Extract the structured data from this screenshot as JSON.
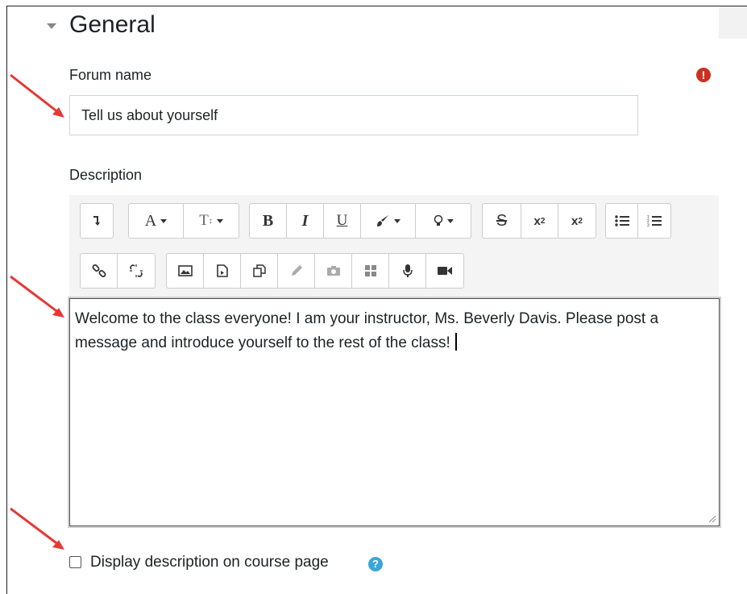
{
  "section": {
    "title": "General",
    "toggle_icon": "chevron-down-icon"
  },
  "forum_name": {
    "label": "Forum name",
    "value": "Tell us about yourself",
    "required_icon": "exclamation-circle-icon",
    "required_color": "#ca3120"
  },
  "description": {
    "label": "Description",
    "text": "Welcome to the class everyone! I am your instructor, Ms. Beverly Davis. Please post a message and introduce yourself to the rest of the class!",
    "toolbar_row1": [
      [
        "collapse-toolbar-icon"
      ],
      [
        "font-family-icon",
        "font-size-icon"
      ],
      [
        "bold-icon",
        "italic-icon",
        "underline-icon",
        "text-color-icon",
        "highlight-icon"
      ],
      [
        "strikethrough-icon",
        "subscript-icon",
        "superscript-icon"
      ],
      [
        "bullet-list-icon",
        "numbered-list-icon"
      ]
    ],
    "toolbar_row2": [
      [
        "link-icon",
        "unlink-icon"
      ],
      [
        "image-icon",
        "media-icon",
        "manage-files-icon",
        "draw-icon",
        "camera-icon",
        "table-icon",
        "record-audio-icon",
        "record-video-icon"
      ]
    ]
  },
  "display_description": {
    "label": "Display description on course page",
    "checked": false,
    "help_icon": "question-circle-icon",
    "help_color": "#3aa6d8"
  },
  "annotation_color": "#e53935"
}
